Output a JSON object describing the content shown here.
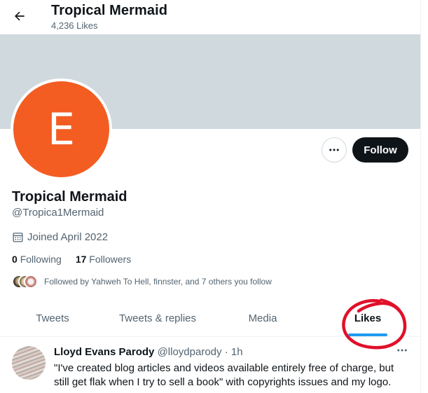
{
  "header": {
    "title": "Tropical Mermaid",
    "subtitle": "4,236 Likes",
    "back_icon": "arrow-left-icon"
  },
  "profile": {
    "avatar_letter": "E",
    "avatar_color": "#f45d22",
    "banner_color": "#cfd9de",
    "display_name": "Tropical Mermaid",
    "handle": "@Tropica1Mermaid",
    "joined": "Joined April 2022",
    "following_count": "0",
    "following_label": "Following",
    "followers_count": "17",
    "followers_label": "Followers",
    "followed_by": "Followed by Yahweh To Hell, finnster, and 7 others you follow"
  },
  "actions": {
    "more_icon": "more-horizontal-icon",
    "follow_label": "Follow"
  },
  "tabs": [
    {
      "label": "Tweets",
      "active": false
    },
    {
      "label": "Tweets & replies",
      "active": false
    },
    {
      "label": "Media",
      "active": false
    },
    {
      "label": "Likes",
      "active": true
    }
  ],
  "colors": {
    "accent": "#1d9bf0",
    "annotation": "#e0102a",
    "text_primary": "#0f1419",
    "text_secondary": "#536471"
  },
  "tweet": {
    "author_name": "Lloyd Evans Parody",
    "author_handle": "@lloydparody",
    "separator": "·",
    "time": "1h",
    "text": "\"I've created blog articles and videos available entirely free of charge, but still get flak when I try to sell a book\" with copyrights issues and my logo."
  }
}
